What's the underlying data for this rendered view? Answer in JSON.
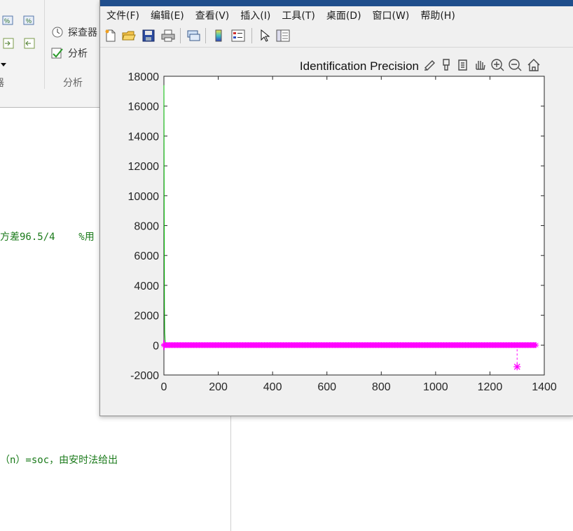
{
  "desktop": {
    "toolstrip": {
      "explorer_label": "探查器",
      "analyze_label": "分析",
      "section_label": "分析",
      "left_section_label": "器"
    },
    "code_lines": {
      "line1": "方差96.5/4    %用",
      "line2": "（n）=soc，由安时法给出"
    }
  },
  "figure": {
    "menu": [
      "文件(F)",
      "编辑(E)",
      "查看(V)",
      "插入(I)",
      "工具(T)",
      "桌面(D)",
      "窗口(W)",
      "帮助(H)"
    ],
    "toolbar_icons": [
      "new-figure-icon",
      "open-file-icon",
      "save-icon",
      "print-icon",
      "link-icon",
      "colorbar-icon",
      "legend-icon",
      "pointer-icon",
      "property-editor-icon"
    ],
    "axes_toolbar_icons": [
      "brush-icon",
      "data-cursor-icon",
      "rotate-icon",
      "pan-icon",
      "zoom-in-icon",
      "zoom-out-icon",
      "home-icon"
    ],
    "colors": {
      "green_series": "#00c000",
      "magenta_series": "#ff00ff",
      "window_bg": "#f0f0f0"
    }
  },
  "chart_data": {
    "type": "line",
    "title": "Identification Precision",
    "xlabel": "",
    "ylabel": "",
    "xlim": [
      0,
      1400
    ],
    "ylim": [
      -2000,
      18000
    ],
    "xticks": [
      0,
      200,
      400,
      600,
      800,
      1000,
      1200,
      1400
    ],
    "yticks": [
      -2000,
      0,
      2000,
      4000,
      6000,
      8000,
      10000,
      12000,
      14000,
      16000,
      18000
    ],
    "grid": false,
    "series": [
      {
        "color": "#00c000",
        "marker": "none",
        "x": [
          0,
          1,
          2,
          3,
          5,
          10,
          20
        ],
        "y": [
          17400,
          9000,
          2500,
          800,
          200,
          50,
          0
        ]
      },
      {
        "color": "#ff00ff",
        "marker": "*",
        "x_range": [
          0,
          1370
        ],
        "y_value": 0,
        "outlier": {
          "x": 1300,
          "y": -1450
        }
      }
    ]
  }
}
